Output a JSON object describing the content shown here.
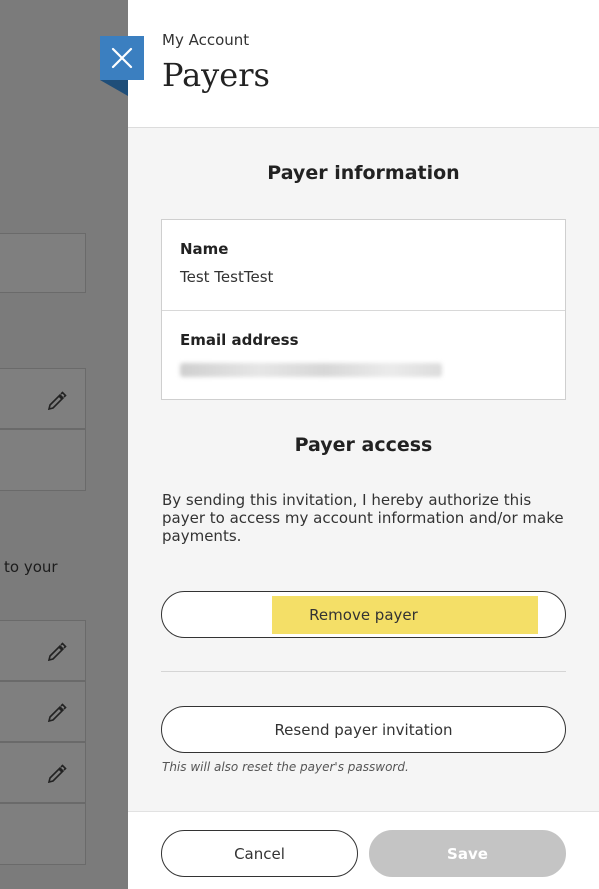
{
  "background": {
    "partial_text": "to your"
  },
  "header": {
    "breadcrumb": "My Account",
    "title": "Payers",
    "close_icon": "close-icon"
  },
  "payer_information": {
    "heading": "Payer information",
    "name_label": "Name",
    "name_value": "Test TestTest",
    "email_label": "Email address"
  },
  "payer_access": {
    "heading": "Payer access",
    "authorization_text": "By sending this invitation, I hereby authorize this payer to access my account information and/or make payments.",
    "remove_label": "Remove payer",
    "resend_label": "Resend payer invitation",
    "reset_note": "This will also reset the payer's password."
  },
  "footer": {
    "cancel_label": "Cancel",
    "save_label": "Save"
  },
  "colors": {
    "accent": "#3b7fc0",
    "highlight": "#f4df67",
    "disabled": "#c4c4c4"
  }
}
